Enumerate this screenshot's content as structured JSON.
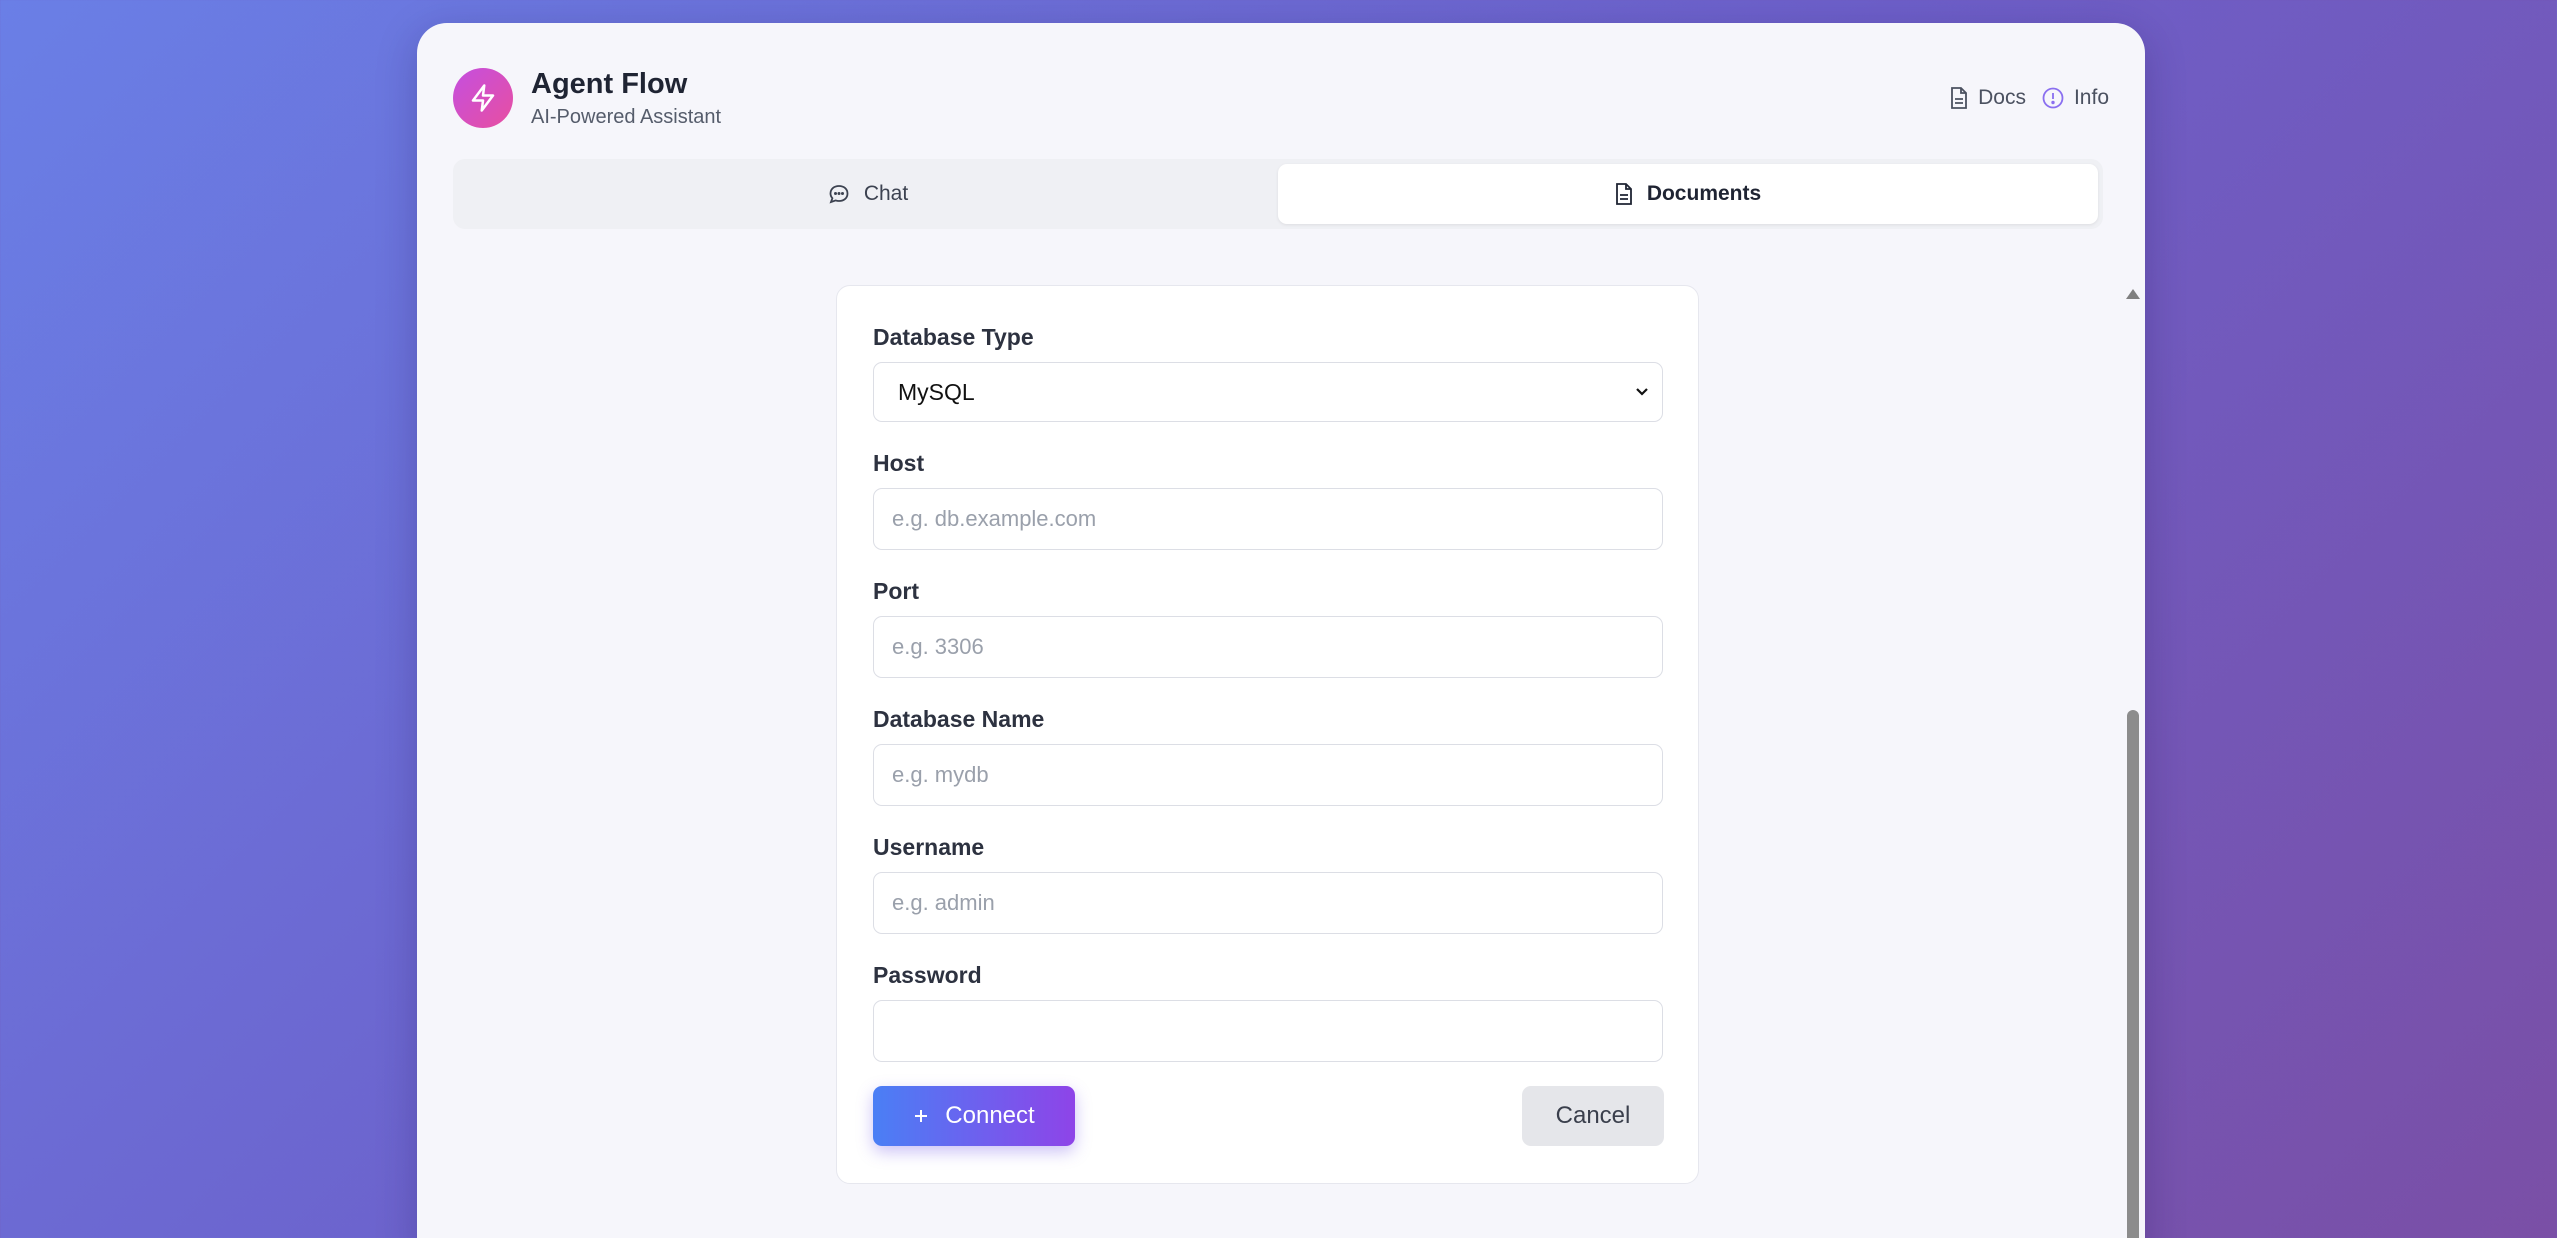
{
  "app": {
    "title": "Agent Flow",
    "subtitle": "AI-Powered Assistant",
    "logo_icon": "bolt-icon"
  },
  "header_links": [
    {
      "label": "Docs",
      "icon": "document-icon"
    },
    {
      "label": "Info",
      "icon": "info-icon"
    }
  ],
  "tabs": [
    {
      "label": "Chat",
      "icon": "chat-bubble-icon",
      "active": false
    },
    {
      "label": "Documents",
      "icon": "document-icon",
      "active": true
    }
  ],
  "form": {
    "database_type": {
      "label": "Database Type",
      "value": "MySQL"
    },
    "host": {
      "label": "Host",
      "placeholder": "e.g. db.example.com",
      "value": ""
    },
    "port": {
      "label": "Port",
      "placeholder": "e.g. 3306",
      "value": ""
    },
    "database_name": {
      "label": "Database Name",
      "placeholder": "e.g. mydb",
      "value": ""
    },
    "username": {
      "label": "Username",
      "placeholder": "e.g. admin",
      "value": ""
    },
    "password": {
      "label": "Password",
      "placeholder": "",
      "value": ""
    },
    "connect_label": "Connect",
    "connect_icon": "plus-icon",
    "cancel_label": "Cancel"
  },
  "colors": {
    "accent_start": "#4a7ff5",
    "accent_end": "#8e44e8",
    "logo_start": "#c44fe0",
    "logo_end": "#e84fa0",
    "background_start": "#6a7fe6",
    "background_end": "#7a4fa6"
  }
}
